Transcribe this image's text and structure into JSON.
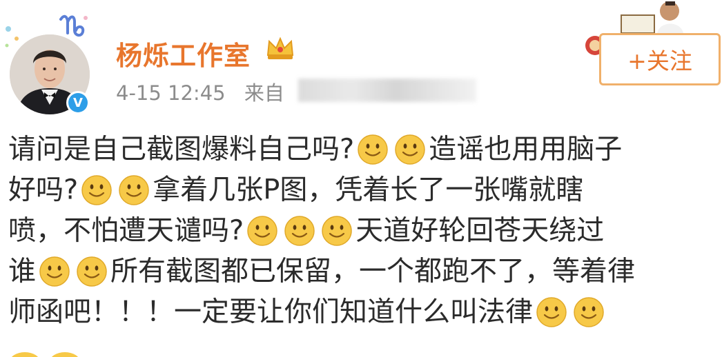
{
  "post": {
    "author": "杨烁工作室",
    "timestamp": "4-15 12:45",
    "source_prefix": "来自",
    "follow_label": "+关注",
    "verified_mark": "V",
    "lines": [
      {
        "segments": [
          {
            "text": "请问是自己截图爆料自己吗?"
          },
          {
            "emoji": "smile-emoji"
          },
          {
            "emoji": "smile-emoji"
          },
          {
            "text": "造谣也用用脑子"
          }
        ]
      },
      {
        "segments": [
          {
            "text": "好吗?"
          },
          {
            "emoji": "smile-emoji"
          },
          {
            "emoji": "smile-emoji"
          },
          {
            "text": "拿着几张P图，凭着长了一张嘴就瞎"
          }
        ]
      },
      {
        "segments": [
          {
            "text": "喷，不怕遭天谴吗?"
          },
          {
            "emoji": "smile-emoji"
          },
          {
            "emoji": "smile-emoji"
          },
          {
            "emoji": "smile-emoji"
          },
          {
            "text": "天道好轮回苍天绕过"
          }
        ]
      },
      {
        "segments": [
          {
            "text": "谁"
          },
          {
            "emoji": "smile-emoji"
          },
          {
            "emoji": "smile-emoji"
          },
          {
            "text": "所有截图都已保留，一个都跑不了，等着律"
          }
        ]
      },
      {
        "segments": [
          {
            "text": "师函吧！！！一定要让你们知道什么叫法律"
          },
          {
            "emoji": "smile-emoji"
          },
          {
            "emoji": "smile-emoji"
          }
        ]
      }
    ]
  },
  "icons": {
    "zodiac": "capricorn-icon",
    "crown": "crown-icon",
    "verified": "verified-icon",
    "emoji": "smile-emoji-icon"
  },
  "colors": {
    "author": "#e8762d",
    "follow_border": "#f0b06a",
    "meta": "#8c8c8c",
    "body_text": "#2b2b2b",
    "verified": "#2d9ee8",
    "emoji_face": "#f7c948"
  }
}
